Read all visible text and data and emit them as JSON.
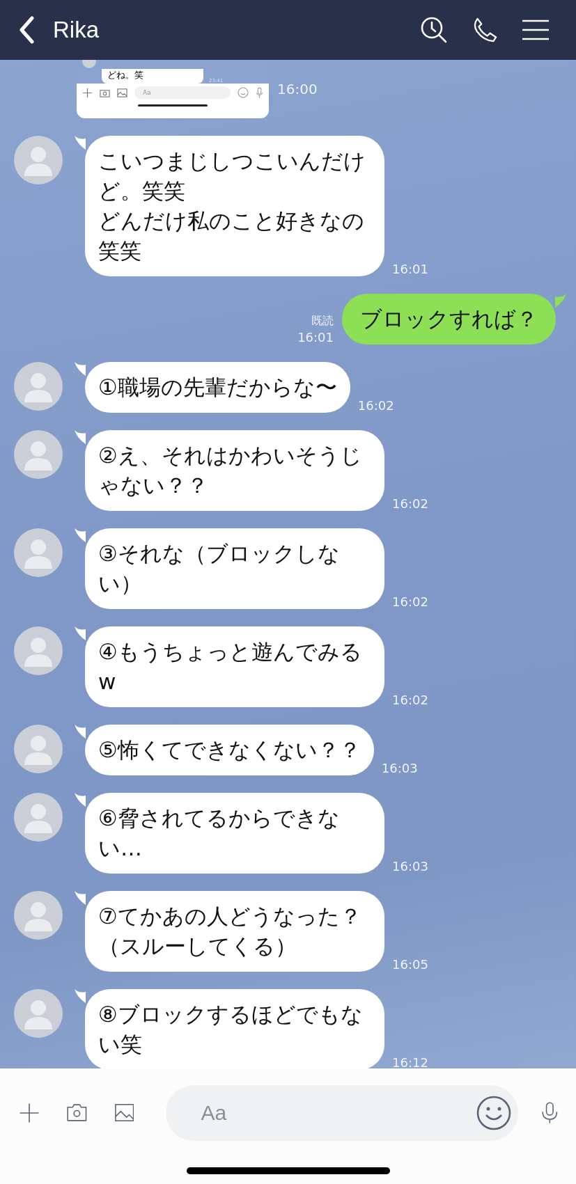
{
  "header": {
    "title": "Rika"
  },
  "messages": [
    {
      "kind": "image",
      "time": "16:00",
      "preview": {
        "text": "どね。笑",
        "time": "23:41",
        "placeholder": "Aa"
      }
    },
    {
      "kind": "received",
      "lines": [
        "こいつまじしつこいんだけど。笑笑",
        "どんだけ私のこと好きなの笑笑"
      ],
      "time": "16:01"
    },
    {
      "kind": "sent",
      "read_label": "既読",
      "lines": [
        "ブロックすれば？"
      ],
      "time": "16:01"
    },
    {
      "kind": "received",
      "lines": [
        "①職場の先輩だからな〜"
      ],
      "time": "16:02"
    },
    {
      "kind": "received",
      "lines": [
        "②え、それはかわいそうじゃない？？"
      ],
      "time": "16:02"
    },
    {
      "kind": "received",
      "lines": [
        "③それな（ブロックしない）"
      ],
      "time": "16:02"
    },
    {
      "kind": "received",
      "lines": [
        "④もうちょっと遊んでみるw"
      ],
      "time": "16:02"
    },
    {
      "kind": "received",
      "lines": [
        "⑤怖くてできなくない？？"
      ],
      "time": "16:03"
    },
    {
      "kind": "received",
      "lines": [
        "⑥脅されてるからできない…"
      ],
      "time": "16:03"
    },
    {
      "kind": "received",
      "lines": [
        "⑦てかあの人どうなった？（スルーしてくる）"
      ],
      "time": "16:05"
    },
    {
      "kind": "received",
      "lines": [
        "⑧ブロックするほどでもない笑"
      ],
      "time": "16:12"
    }
  ],
  "composer": {
    "placeholder": "Aa"
  }
}
